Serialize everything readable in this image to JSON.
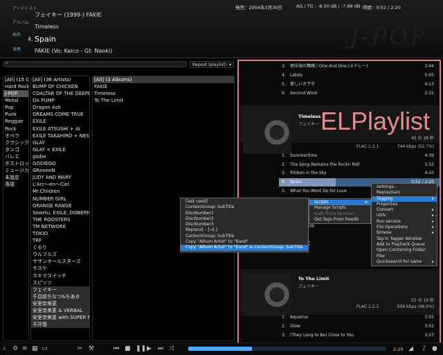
{
  "header": {
    "labels": {
      "artist": "アーティスト",
      "album": "アルバム",
      "title": "曲名",
      "performer": "演奏"
    },
    "artist": "フェイキー (1999-) FAKIE",
    "album": "Timeless",
    "track_no": "4.",
    "title": "Spain",
    "performer": "FAKIE (Vo: Keico - Gt: Naoki)",
    "release": "発売：2004年3月30日",
    "gain": "AG / TG : -8.50 dB / -7.88 dB",
    "time": "時間 : 0:52 / 2:20",
    "genre_logo": "J-POP"
  },
  "repeat_mode": "Repeat (playlist)",
  "genres": {
    "header": "[All] (15 Genres)",
    "items": [
      "Hard Rock",
      "J-POP",
      "Metal",
      "Pop",
      "Punk",
      "Reggae",
      "Rock",
      "オペラ",
      "クラシック",
      "タンゴ",
      "バレエ",
      "ポストロック",
      "ミュージカル",
      "未設定",
      "落語"
    ],
    "selected": "J-POP"
  },
  "artists": {
    "header": "[All] (36 Artists)",
    "items": [
      "BUMP OF CHICKEN",
      "COALTAR OF THE DEEPERS",
      "DA PUMP",
      "Dragon Ash",
      "DREAMS COME TRUE",
      "EXILE",
      "EXILE ATSUSHI + AI",
      "EXILE TAKAHIRO + NESMITH",
      "GLAY",
      "GLAY × EXILE",
      "globe",
      "GODIEGO",
      "GReeeeN",
      "JUDY AND MARY",
      "L'Arc〜en〜Ciel",
      "Mr.Children",
      "NUMBER GIRL",
      "ORANGE RANGE",
      "Sowelu, EXILE, DOBERMAN",
      "THE ROOSTERS",
      "TM NETWORK",
      "TOKIO",
      "TRF",
      "くるり",
      "ウルフルズ",
      "サザンオールスターズ",
      "サスケ",
      "スキマスイッチ",
      "スピッツ",
      "フェイキー",
      "千目前ちなつ&ちあき",
      "安室奈美恵",
      "安室奈美恵 & VERBAL",
      "安室奈美恵 with SUPER MONKEY'S",
      "平井堅"
    ],
    "selected": "フェイキー"
  },
  "albums": {
    "header": "[All] (3 Albums)",
    "items": [
      "FAKIE",
      "Timeless",
      "To The Limit"
    ]
  },
  "playlist": {
    "overlay": "ELPlaylist",
    "top_tracks": [
      {
        "n": "3.",
        "t": "地中海の舞踊 / One And One (メドレー)",
        "d": "3:44"
      },
      {
        "n": "4.",
        "t": "Lately",
        "d": "5:05"
      },
      {
        "n": "5.",
        "t": "愛しいカラダ",
        "d": "4:13"
      },
      {
        "n": "6.",
        "t": "Second Wind",
        "d": "2:31"
      }
    ],
    "group2": {
      "album": "Timeless",
      "artist": "フェイキー",
      "info1": "45 分 28 秒",
      "codec": "FLAC 1.2.1",
      "info2": "744 kbps (52.7%)",
      "tracks": [
        {
          "n": "1.",
          "t": "Summertime",
          "d": "4:39"
        },
        {
          "n": "2.",
          "t": "The Song Remains the Rockn Roll",
          "d": "1:52"
        },
        {
          "n": "3.",
          "t": "Ribbon in the Sky",
          "d": "4:10"
        },
        {
          "n": "4.",
          "t": "Spain",
          "d": "0:52 / 2:20"
        },
        {
          "n": "5.",
          "t": "What You Wont Do for Love",
          "d": ""
        },
        {
          "n": "",
          "t": "",
          "d": ""
        },
        {
          "n": "",
          "t": "",
          "d": ""
        },
        {
          "n": "",
          "t": "Spain Around",
          "d": ""
        },
        {
          "n": "",
          "t": "of the Earth",
          "d": ""
        },
        {
          "n": "",
          "t": "ight",
          "d": ""
        },
        {
          "n": "10.",
          "t": "ここさせて",
          "d": ""
        }
      ]
    },
    "group3": {
      "album": "To The Limit",
      "artist": "フェイキー",
      "info1": "55 分 19 秒",
      "codec": "FLAC 1.2.1",
      "info2": "699 kbps (49.5%)",
      "tracks": [
        {
          "n": "1.",
          "t": "Aquarius",
          "d": "3:55"
        },
        {
          "n": "2.",
          "t": "Glow",
          "d": "3:52"
        },
        {
          "n": "3.",
          "t": "(They Long to Be) Close to You",
          "d": "3:27"
        }
      ]
    }
  },
  "menus": {
    "main": [
      "Settings...",
      "ReplayGain",
      "Tagging",
      "Properties",
      "Convert",
      "Utils",
      "Run service",
      "File Operations",
      "Browse",
      "Tag in Tagger Window",
      "Add to Playback Queue",
      "Open Containing Folder",
      "Filer",
      "Quicksearch for same"
    ],
    "tagging": [
      "Scripts",
      "Manage Scripts",
      "Get Tags From freedb"
    ],
    "tagging_hidden": "Auto Track Number",
    "scripts": [
      "[last used]",
      "ContentGroup: SubTitle",
      "DiscNumber1",
      "DiscNumber2",
      "DiscNumber3",
      "Replace[ - ]→[.]",
      "ContentGroup: SubTitle",
      "Copy \"Album Artist\" to \"Band\"",
      "Copy \"Album Artist\" to \"Band\" & ContentGroup: SubTitle"
    ]
  },
  "status": {
    "elapsed": "2:20"
  },
  "progress": 0.32
}
